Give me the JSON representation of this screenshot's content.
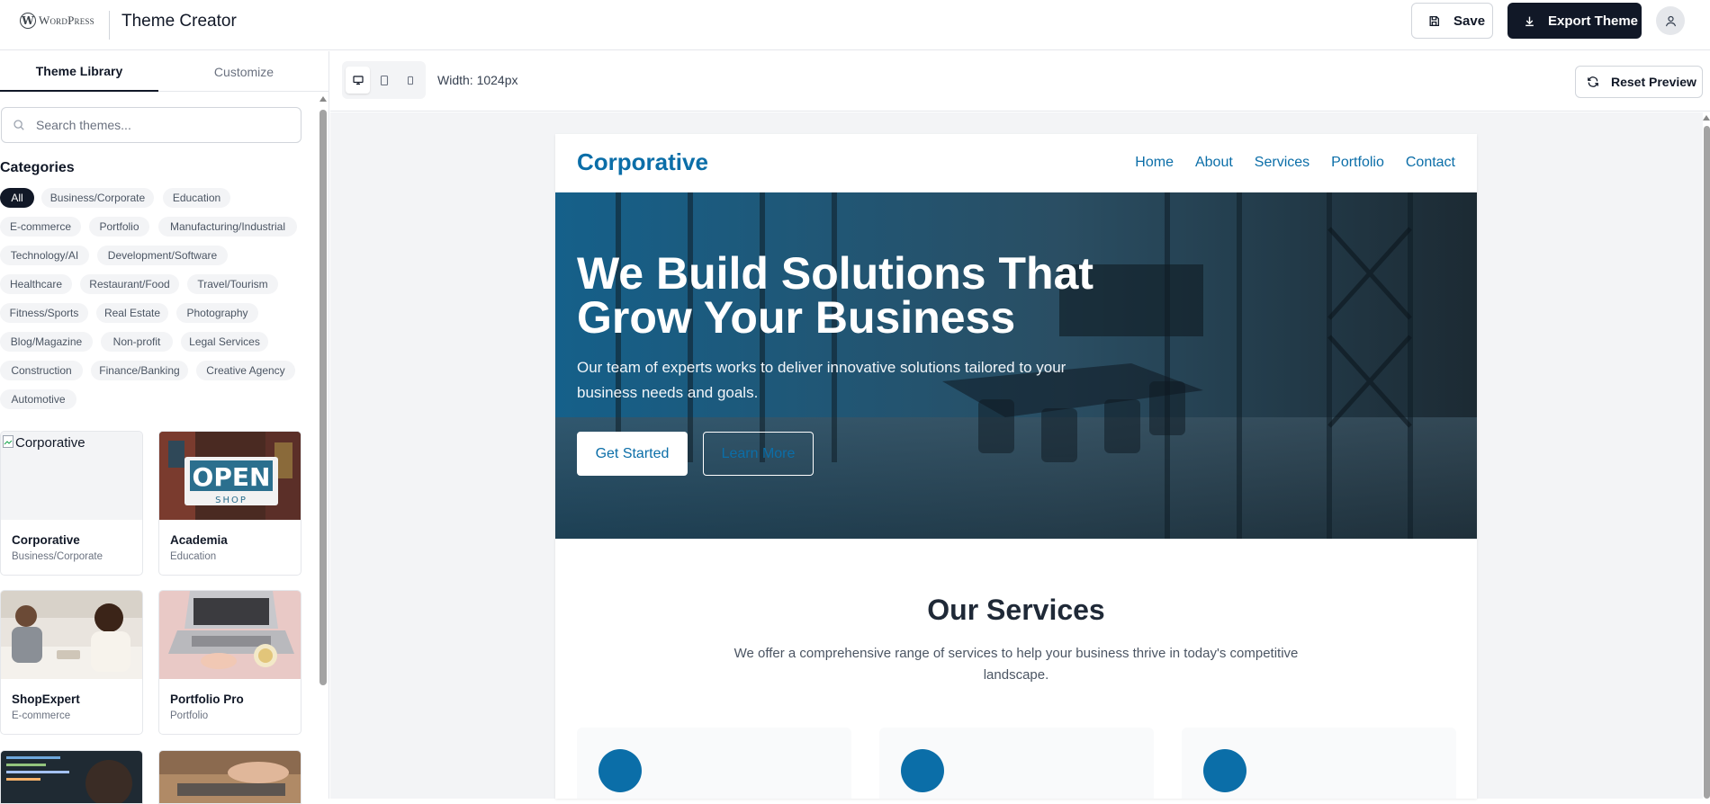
{
  "header": {
    "logo_text": "WordPress",
    "app_title": "Theme Creator",
    "save_label": "Save",
    "export_label": "Export Theme",
    "icons": {
      "save": "floppy-disk-icon",
      "export": "download-icon",
      "user": "user-icon"
    }
  },
  "sidebar": {
    "tabs": [
      "Theme Library",
      "Customize"
    ],
    "active_tab": "Theme Library",
    "search_placeholder": "Search themes...",
    "categories_title": "Categories",
    "categories": [
      "All",
      "Business/Corporate",
      "Education",
      "E-commerce",
      "Portfolio",
      "Manufacturing/Industrial",
      "Technology/AI",
      "Development/Software",
      "Healthcare",
      "Restaurant/Food",
      "Travel/Tourism",
      "Fitness/Sports",
      "Real Estate",
      "Photography",
      "Blog/Magazine",
      "Non-profit",
      "Legal Services",
      "Construction",
      "Finance/Banking",
      "Creative Agency",
      "Automotive"
    ],
    "active_category": "All",
    "themes": [
      {
        "name": "Corporative",
        "category": "Business/Corporate",
        "alt": "Corporative"
      },
      {
        "name": "Academia",
        "category": "Education",
        "sign_top": "OPEN",
        "sign_bottom": "SHOP"
      },
      {
        "name": "ShopExpert",
        "category": "E-commerce"
      },
      {
        "name": "Portfolio Pro",
        "category": "Portfolio"
      }
    ]
  },
  "toolbar": {
    "devices": [
      "desktop-icon",
      "tablet-icon",
      "mobile-icon"
    ],
    "active_device": "desktop",
    "width_prefix": "Width:",
    "width_value": "1024px",
    "reset_label": "Reset Preview"
  },
  "preview": {
    "logo": "Corporative",
    "nav": [
      "Home",
      "About",
      "Services",
      "Portfolio",
      "Contact"
    ],
    "hero_title": "We Build Solutions That Grow Your Business",
    "hero_subtitle": "Our team of experts works to deliver innovative solutions tailored to your business needs and goals.",
    "cta_primary": "Get Started",
    "cta_secondary": "Learn More",
    "services_title": "Our Services",
    "services_subtitle": "We offer a comprehensive range of services to help your business thrive in today's competitive landscape."
  },
  "colors": {
    "brand": "#0b6ea8",
    "dark": "#111827",
    "chip_bg": "#f3f4f6"
  }
}
